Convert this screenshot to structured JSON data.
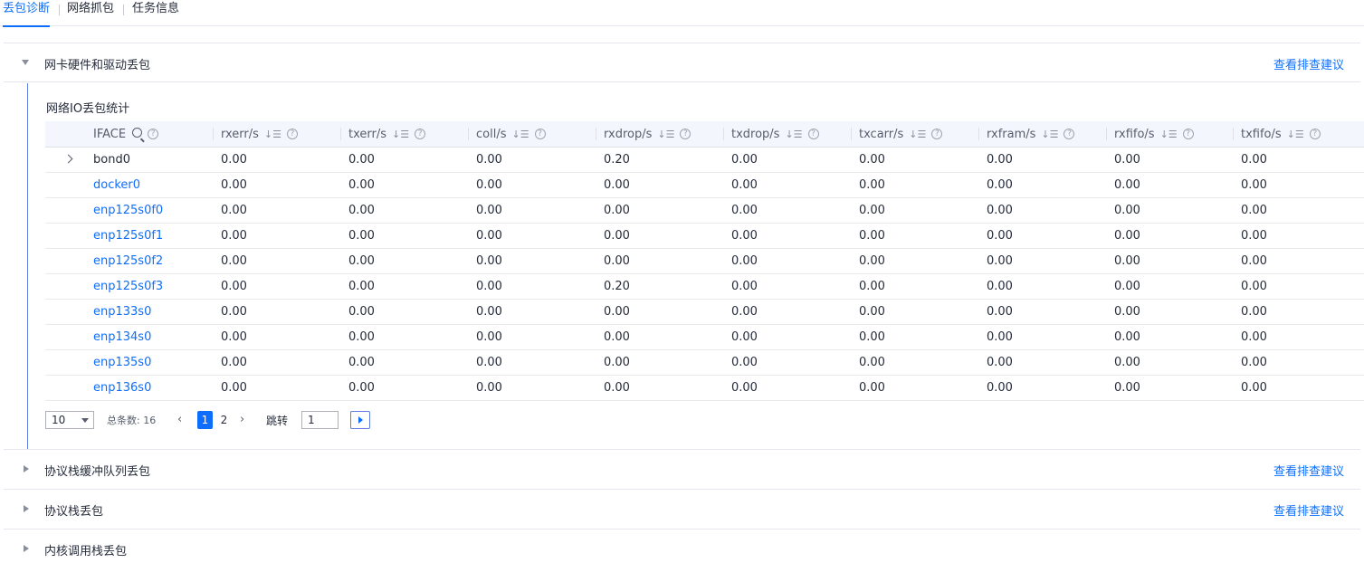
{
  "tabs": [
    {
      "label": "丢包诊断",
      "active": true
    },
    {
      "label": "网络抓包",
      "active": false
    },
    {
      "label": "任务信息",
      "active": false
    }
  ],
  "panels": [
    {
      "title": "网卡硬件和驱动丢包",
      "link": "查看排查建议",
      "expanded": true
    },
    {
      "title": "协议栈缓冲队列丢包",
      "link": "查看排查建议",
      "expanded": false
    },
    {
      "title": "协议栈丢包",
      "link": "查看排查建议",
      "expanded": false
    },
    {
      "title": "内核调用栈丢包",
      "link": "",
      "expanded": false
    }
  ],
  "section": {
    "title": "网络IO丢包统计"
  },
  "table": {
    "columns": [
      "IFACE",
      "rxerr/s",
      "txerr/s",
      "coll/s",
      "rxdrop/s",
      "txdrop/s",
      "txcarr/s",
      "rxfram/s",
      "rxfifo/s",
      "txfifo/s"
    ],
    "rows": [
      {
        "iface": "bond0",
        "link": false,
        "expandable": true,
        "values": [
          "0.00",
          "0.00",
          "0.00",
          "0.20",
          "0.00",
          "0.00",
          "0.00",
          "0.00",
          "0.00"
        ]
      },
      {
        "iface": "docker0",
        "link": true,
        "expandable": false,
        "values": [
          "0.00",
          "0.00",
          "0.00",
          "0.00",
          "0.00",
          "0.00",
          "0.00",
          "0.00",
          "0.00"
        ]
      },
      {
        "iface": "enp125s0f0",
        "link": true,
        "expandable": false,
        "values": [
          "0.00",
          "0.00",
          "0.00",
          "0.00",
          "0.00",
          "0.00",
          "0.00",
          "0.00",
          "0.00"
        ]
      },
      {
        "iface": "enp125s0f1",
        "link": true,
        "expandable": false,
        "values": [
          "0.00",
          "0.00",
          "0.00",
          "0.00",
          "0.00",
          "0.00",
          "0.00",
          "0.00",
          "0.00"
        ]
      },
      {
        "iface": "enp125s0f2",
        "link": true,
        "expandable": false,
        "values": [
          "0.00",
          "0.00",
          "0.00",
          "0.00",
          "0.00",
          "0.00",
          "0.00",
          "0.00",
          "0.00"
        ]
      },
      {
        "iface": "enp125s0f3",
        "link": true,
        "expandable": false,
        "values": [
          "0.00",
          "0.00",
          "0.00",
          "0.20",
          "0.00",
          "0.00",
          "0.00",
          "0.00",
          "0.00"
        ]
      },
      {
        "iface": "enp133s0",
        "link": true,
        "expandable": false,
        "values": [
          "0.00",
          "0.00",
          "0.00",
          "0.00",
          "0.00",
          "0.00",
          "0.00",
          "0.00",
          "0.00"
        ]
      },
      {
        "iface": "enp134s0",
        "link": true,
        "expandable": false,
        "values": [
          "0.00",
          "0.00",
          "0.00",
          "0.00",
          "0.00",
          "0.00",
          "0.00",
          "0.00",
          "0.00"
        ]
      },
      {
        "iface": "enp135s0",
        "link": true,
        "expandable": false,
        "values": [
          "0.00",
          "0.00",
          "0.00",
          "0.00",
          "0.00",
          "0.00",
          "0.00",
          "0.00",
          "0.00"
        ]
      },
      {
        "iface": "enp136s0",
        "link": true,
        "expandable": false,
        "values": [
          "0.00",
          "0.00",
          "0.00",
          "0.00",
          "0.00",
          "0.00",
          "0.00",
          "0.00",
          "0.00"
        ]
      }
    ]
  },
  "pagination": {
    "page_size": "10",
    "total_label": "总条数: 16",
    "pages": [
      "1",
      "2"
    ],
    "current_page": "1",
    "jump_label": "跳转",
    "jump_value": "1"
  },
  "icons": {
    "search": "search-icon",
    "sort": "sort-icon",
    "help": "help-icon"
  },
  "colors": {
    "accent": "#0d6efd",
    "header_bg": "#f3f6fc"
  }
}
